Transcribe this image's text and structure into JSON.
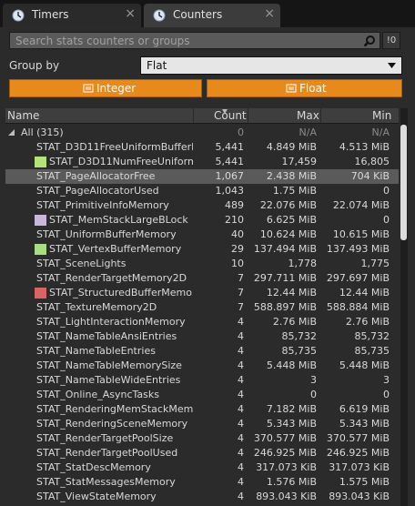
{
  "tabs": [
    {
      "label": "Timers",
      "icon": "clock-icon"
    },
    {
      "label": "Counters",
      "icon": "clock-icon"
    }
  ],
  "tab_close_glyph": "×",
  "search": {
    "placeholder": "Search stats counters or groups",
    "reset_label": "!0"
  },
  "group_by": {
    "label": "Group by",
    "value": "Flat"
  },
  "type_buttons": {
    "integer": "Integer",
    "float": "Float"
  },
  "columns": {
    "name": "Name",
    "count": "Count",
    "max": "Max",
    "min": "Min"
  },
  "colors": {
    "accent": "#e8891c",
    "selected_row": "#5a5a5a"
  },
  "rows": [
    {
      "name": "All (315)",
      "count": "0",
      "max": "N/A",
      "min": "N/A",
      "group": true,
      "dim": true
    },
    {
      "name": "STAT_D3D11FreeUniformBufferMe",
      "count": "5,441",
      "max": "4.849 MiB",
      "min": "4.513 MiB"
    },
    {
      "name": "STAT_D3D11NumFreeUniformB",
      "count": "5,441",
      "max": "17,459",
      "min": "16,805",
      "swatch": "#b6e07a"
    },
    {
      "name": "STAT_PageAllocatorFree",
      "count": "1,067",
      "max": "2.438 MiB",
      "min": "704 KiB",
      "selected": true
    },
    {
      "name": "STAT_PageAllocatorUsed",
      "count": "1,043",
      "max": "1.75 MiB",
      "min": "0"
    },
    {
      "name": "STAT_PrimitiveInfoMemory",
      "count": "489",
      "max": "22.076 MiB",
      "min": "22.074 MiB"
    },
    {
      "name": "STAT_MemStackLargeBLock",
      "count": "210",
      "max": "6.625 MiB",
      "min": "0",
      "swatch": "#c9b6dc"
    },
    {
      "name": "STAT_UniformBufferMemory",
      "count": "40",
      "max": "10.624 MiB",
      "min": "10.615 MiB"
    },
    {
      "name": "STAT_VertexBufferMemory",
      "count": "29",
      "max": "137.494 MiB",
      "min": "137.493 MiB",
      "swatch": "#a9dd82"
    },
    {
      "name": "STAT_SceneLights",
      "count": "10",
      "max": "1,778",
      "min": "1,775"
    },
    {
      "name": "STAT_RenderTargetMemory2D",
      "count": "7",
      "max": "297.711 MiB",
      "min": "297.697 MiB"
    },
    {
      "name": "STAT_StructuredBufferMemory",
      "count": "7",
      "max": "12.44 MiB",
      "min": "12.44 MiB",
      "swatch": "#d96464"
    },
    {
      "name": "STAT_TextureMemory2D",
      "count": "7",
      "max": "588.897 MiB",
      "min": "588.884 MiB"
    },
    {
      "name": "STAT_LightInteractionMemory",
      "count": "4",
      "max": "2.76 MiB",
      "min": "2.76 MiB"
    },
    {
      "name": "STAT_NameTableAnsiEntries",
      "count": "4",
      "max": "85,732",
      "min": "85,732"
    },
    {
      "name": "STAT_NameTableEntries",
      "count": "4",
      "max": "85,735",
      "min": "85,735"
    },
    {
      "name": "STAT_NameTableMemorySize",
      "count": "4",
      "max": "5.448 MiB",
      "min": "5.448 MiB"
    },
    {
      "name": "STAT_NameTableWideEntries",
      "count": "4",
      "max": "3",
      "min": "3"
    },
    {
      "name": "STAT_Online_AsyncTasks",
      "count": "4",
      "max": "0",
      "min": "0"
    },
    {
      "name": "STAT_RenderingMemStackMemor",
      "count": "4",
      "max": "7.182 MiB",
      "min": "6.619 MiB"
    },
    {
      "name": "STAT_RenderingSceneMemory",
      "count": "4",
      "max": "5.343 MiB",
      "min": "5.343 MiB"
    },
    {
      "name": "STAT_RenderTargetPoolSize",
      "count": "4",
      "max": "370.577 MiB",
      "min": "370.577 MiB"
    },
    {
      "name": "STAT_RenderTargetPoolUsed",
      "count": "4",
      "max": "246.925 MiB",
      "min": "246.925 MiB"
    },
    {
      "name": "STAT_StatDescMemory",
      "count": "4",
      "max": "317.073 KiB",
      "min": "317.073 KiB"
    },
    {
      "name": "STAT_StatMessagesMemory",
      "count": "4",
      "max": "1.576 MiB",
      "min": "1.575 MiB"
    },
    {
      "name": "STAT_ViewStateMemory",
      "count": "4",
      "max": "893.043 KiB",
      "min": "893.043 KiB"
    }
  ]
}
